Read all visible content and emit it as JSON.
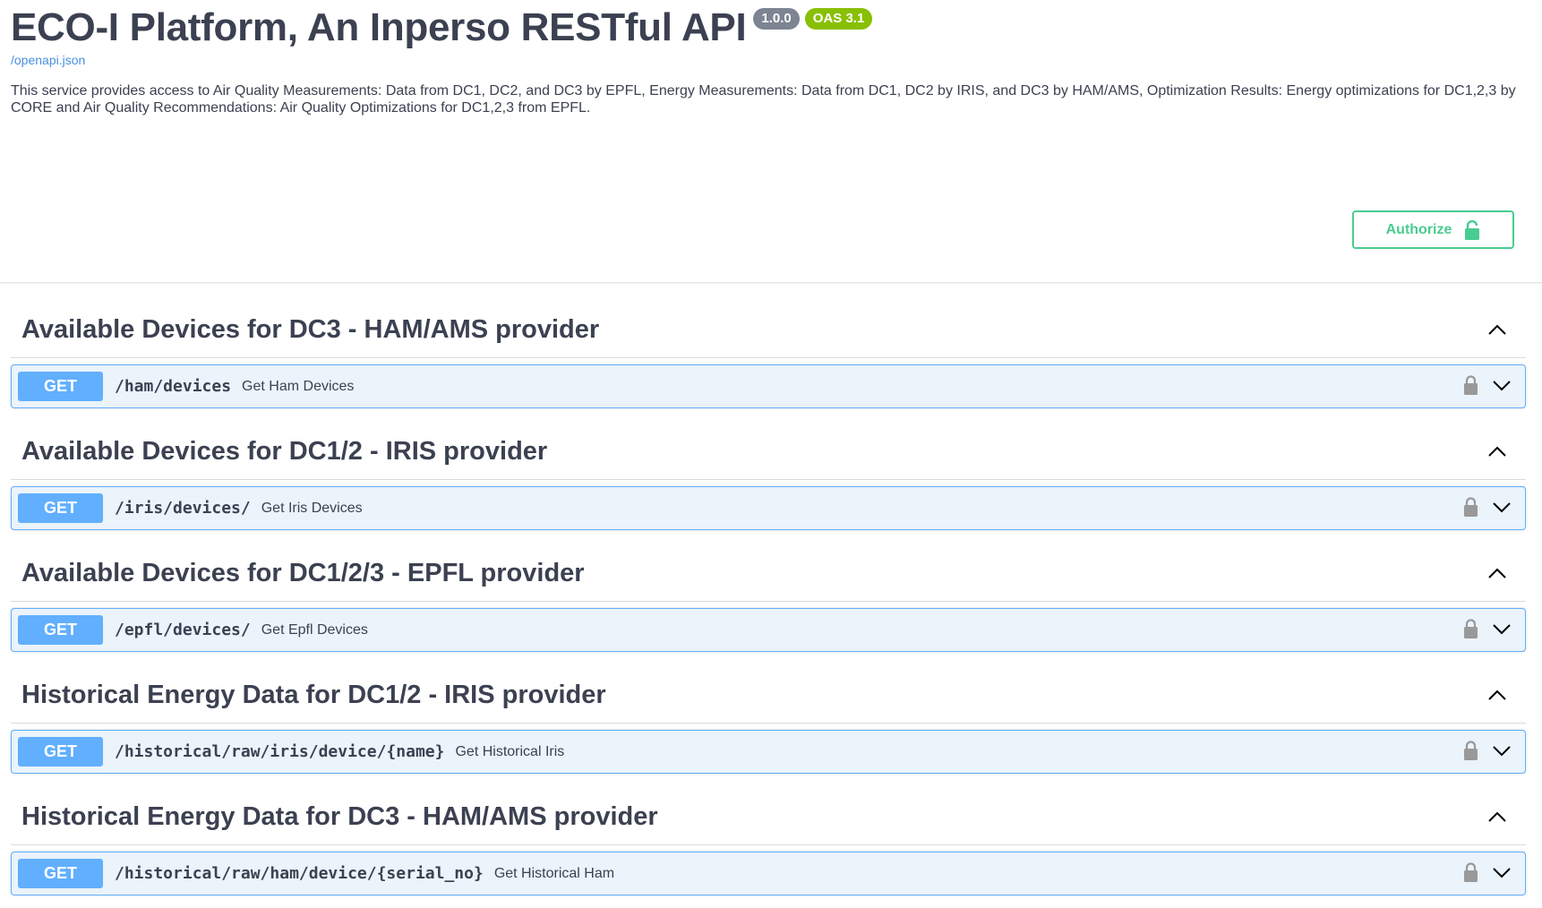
{
  "info": {
    "title": "ECO-I Platform, An Inperso RESTful API",
    "version_badge": "1.0.0",
    "oas_badge": "OAS 3.1",
    "spec_link": "/openapi.json",
    "description": "This service provides access to Air Quality Measurements: Data from DC1, DC2, and DC3 by EPFL, Energy Measurements: Data from DC1, DC2 by IRIS, and DC3 by HAM/AMS, Optimization Results: Energy optimizations for DC1,2,3 by CORE and Air Quality Recommendations: Air Quality Optimizations for DC1,2,3 from EPFL."
  },
  "auth": {
    "button_label": "Authorize",
    "icon": "unlocked-icon"
  },
  "colors": {
    "get": "#61affe",
    "authorize": "#49cc90",
    "version": "#7d8492",
    "oas": "#89bf04"
  },
  "sections": [
    {
      "title": "Available Devices for DC3 - HAM/AMS provider",
      "op": {
        "method": "GET",
        "path": "/ham/devices",
        "summary": "Get Ham Devices"
      }
    },
    {
      "title": "Available Devices for DC1/2 - IRIS provider",
      "op": {
        "method": "GET",
        "path": "/iris/devices/",
        "summary": "Get Iris Devices"
      }
    },
    {
      "title": "Available Devices for DC1/2/3 - EPFL provider",
      "op": {
        "method": "GET",
        "path": "/epfl/devices/",
        "summary": "Get Epfl Devices"
      }
    },
    {
      "title": "Historical Energy Data for DC1/2 - IRIS provider",
      "op": {
        "method": "GET",
        "path": "/historical/raw/iris/device/{name}",
        "summary": "Get Historical Iris"
      }
    },
    {
      "title": "Historical Energy Data for DC3 - HAM/AMS provider",
      "op": {
        "method": "GET",
        "path": "/historical/raw/ham/device/{serial_no}",
        "summary": "Get Historical Ham"
      }
    }
  ]
}
